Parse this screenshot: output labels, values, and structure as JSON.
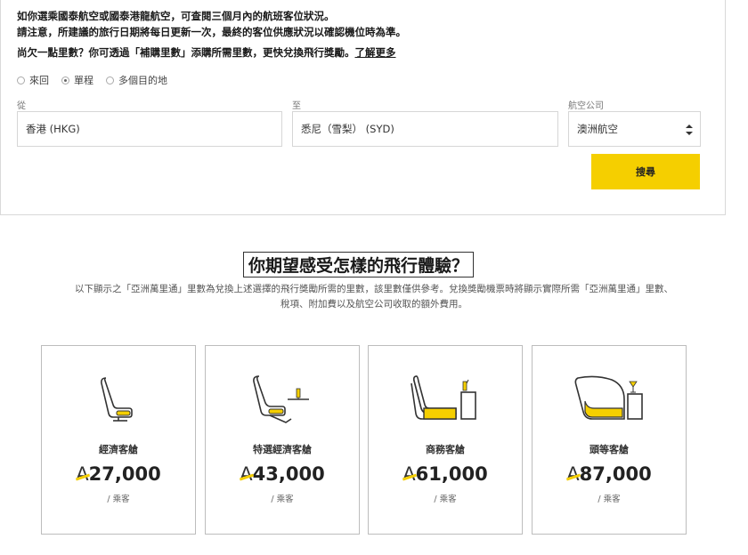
{
  "info": {
    "line1": "如你選乘國泰航空或國泰港龍航空，可查閱三個月內的航班客位狀況。",
    "line2": "請注意，所建議的旅行日期將每日更新一次，最終的客位供應狀況以確認機位時為準。",
    "line3": "尚欠一點里數？你可透過「補購里數」添購所需里數，更快兌換飛行獎勵。",
    "learn_more": "了解更多"
  },
  "trip_types": [
    {
      "label": "來回",
      "checked": false
    },
    {
      "label": "單程",
      "checked": true
    },
    {
      "label": "多個目的地",
      "checked": false
    }
  ],
  "form": {
    "from_label": "從",
    "from_value": "香港 (HKG)",
    "to_label": "至",
    "to_value": "悉尼（雪梨） (SYD)",
    "airline_label": "航空公司",
    "airline_value": "澳洲航空",
    "search_label": "搜尋"
  },
  "experience": {
    "title": "你期望感受怎樣的飛行體驗？",
    "description": "以下顯示之「亞洲萬里通」里數為兌換上述選擇的飛行獎勵所需的里數，該里數僅供參考。兌換獎勵機票時將顯示實際所需「亞洲萬里通」里數、稅項、附加費以及航空公司收取的額外費用。"
  },
  "currency_symbol": "A",
  "accent_color": "#f5cf00",
  "cabins": [
    {
      "name": "經濟客艙",
      "miles": "27,000",
      "per": "/ 乘客",
      "icon": "economy-seat-icon"
    },
    {
      "name": "特選經濟客艙",
      "miles": "43,000",
      "per": "/ 乘客",
      "icon": "premium-economy-seat-icon"
    },
    {
      "name": "商務客艙",
      "miles": "61,000",
      "per": "/ 乘客",
      "icon": "business-seat-icon"
    },
    {
      "name": "頭等客艙",
      "miles": "87,000",
      "per": "/ 乘客",
      "icon": "first-seat-icon"
    }
  ]
}
